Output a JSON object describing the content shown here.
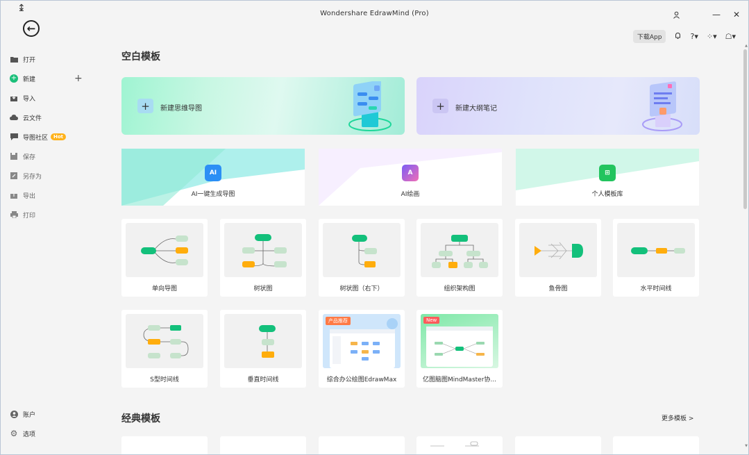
{
  "window": {
    "title": "Wondershare EdrawMind (Pro)",
    "minimize": "—",
    "close": "✕"
  },
  "sidebar": {
    "items": [
      {
        "id": "open",
        "label": "打开"
      },
      {
        "id": "new",
        "label": "新建"
      },
      {
        "id": "import",
        "label": "导入"
      },
      {
        "id": "cloud",
        "label": "云文件"
      },
      {
        "id": "community",
        "label": "导图社区",
        "badge": "Hot"
      },
      {
        "id": "save",
        "label": "保存"
      },
      {
        "id": "saveas",
        "label": "另存为"
      },
      {
        "id": "export",
        "label": "导出"
      },
      {
        "id": "print",
        "label": "打印"
      }
    ],
    "bottom": [
      {
        "id": "account",
        "label": "账户"
      },
      {
        "id": "options",
        "label": "选项"
      }
    ]
  },
  "toolbar": {
    "download_app": "下载App"
  },
  "sections": {
    "blank": "空白模板",
    "classic": "经典模板",
    "more": "更多模板 >"
  },
  "big_cards": [
    {
      "id": "new-mindmap",
      "label": "新建思维导图"
    },
    {
      "id": "new-outline",
      "label": "新建大纲笔记"
    }
  ],
  "mid_cards": [
    {
      "id": "ai-mindmap",
      "label": "AI一键生成导图",
      "icon_text": "AI"
    },
    {
      "id": "ai-draw",
      "label": "AI绘画",
      "icon_text": "A"
    },
    {
      "id": "personal",
      "label": "个人模板库",
      "icon_text": "⊞"
    }
  ],
  "templates": [
    {
      "id": "one-way",
      "label": "单向导图"
    },
    {
      "id": "tree",
      "label": "树状图"
    },
    {
      "id": "tree-right",
      "label": "树状图（右下）"
    },
    {
      "id": "org",
      "label": "组织架构图"
    },
    {
      "id": "fishbone",
      "label": "鱼骨图"
    },
    {
      "id": "timeline-h",
      "label": "水平时间线"
    },
    {
      "id": "timeline-s",
      "label": "S型时间线"
    },
    {
      "id": "timeline-v",
      "label": "垂直时间线"
    },
    {
      "id": "edrawmax",
      "label": "综合办公绘图EdrawMax",
      "tag": "产品推荐"
    },
    {
      "id": "mindmaster",
      "label": "亿图脑图MindMaster协...",
      "tag": "New"
    }
  ],
  "colors": {
    "green": "#13c07b",
    "orange": "#ffad0d",
    "light_green": "#c6e3cc",
    "hot": "#ffb21a"
  }
}
